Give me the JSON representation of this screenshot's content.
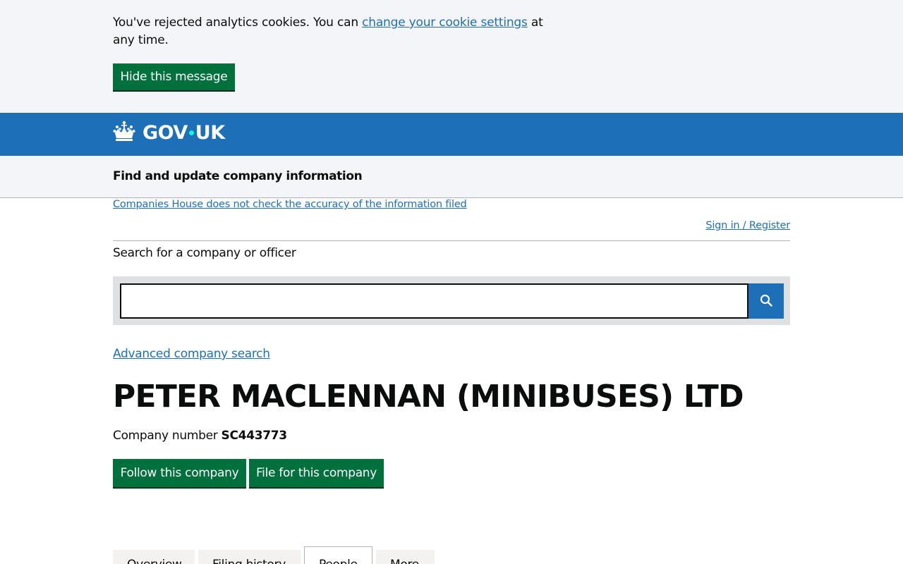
{
  "cookie_banner": {
    "text_before": "You've rejected analytics cookies. You can ",
    "link": "change your cookie settings",
    "text_after": " at any time.",
    "hide_button": "Hide this message"
  },
  "header": {
    "logo_text_1": "GOV",
    "logo_text_2": "UK"
  },
  "service": {
    "name": "Find and update company information"
  },
  "notices": {
    "accuracy_link": "Companies House does not check the accuracy of the information filed",
    "signin": "Sign in / Register"
  },
  "search": {
    "label": "Search for a company or officer",
    "value": ""
  },
  "advanced_search": "Advanced company search",
  "company": {
    "name": "PETER MACLENNAN (MINIBUSES) LTD",
    "number_label": "Company number",
    "number": "SC443773"
  },
  "actions": {
    "follow": "Follow this company",
    "file": "File for this company"
  },
  "tabs": [
    {
      "label": "Overview"
    },
    {
      "label": "Filing history"
    },
    {
      "label": "People"
    },
    {
      "label": "More"
    }
  ],
  "colors": {
    "govuk_blue": "#1d70b8",
    "button_green": "#00703c",
    "link_blue": "#1d70b8",
    "banner_bg": "#f3f5f8"
  }
}
